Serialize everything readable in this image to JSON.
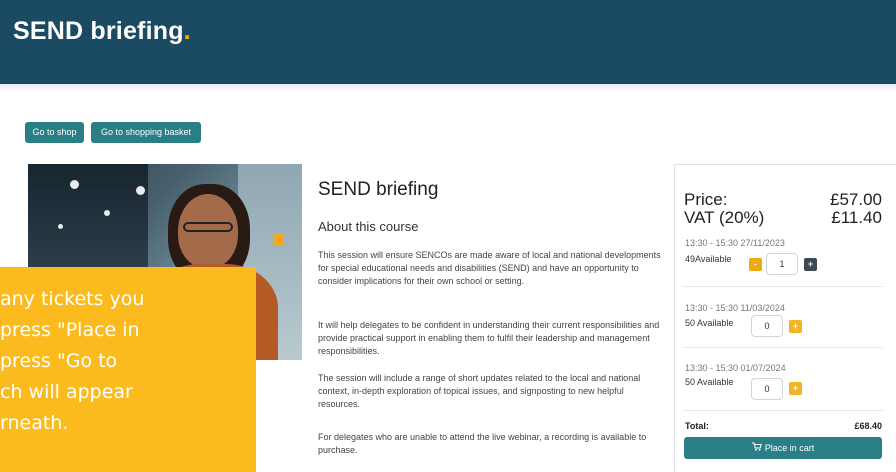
{
  "header": {
    "brand": "SEND briefing",
    "brand_dot": "."
  },
  "nav_buttons": {
    "shop": "Go to shop",
    "basket": "Go to shopping basket"
  },
  "overlay_lines": [
    "any tickets you",
    " press \"Place in",
    "press \"Go to",
    "ch will appear",
    "rneath."
  ],
  "course": {
    "title": "SEND briefing",
    "about_heading": "About this course",
    "paragraphs": [
      "This session will ensure SENCOs are made aware of local and national developments for special educational needs and disabilities (SEND) and have an opportunity to consider implications for their own school or setting.",
      "It will help delegates to be confident in understanding their current responsibilities and provide practical support in enabling them to fulfil their leadership and management responsibilities.",
      "The session will include a range of short updates related to the local and national context, in-depth exploration of topical issues, and signposting to new helpful resources.",
      "For delegates who are unable to attend the live webinar, a recording is available to purchase."
    ]
  },
  "pricing": {
    "price_label": "Price:",
    "price_value": "£57.00",
    "vat_label": "VAT (20%)",
    "vat_value": "£11.40"
  },
  "sessions": [
    {
      "date": "13:30 - 15:30 27/11/2023",
      "available": "49Available",
      "quantity": "1",
      "minus": "-",
      "plus": "+"
    },
    {
      "date": "13:30 - 15:30 11/03/2024",
      "available": "50 Available",
      "quantity": "0",
      "plus": "+"
    },
    {
      "date": "13:30 - 15:30 01/07/2024",
      "available": "50 Available",
      "quantity": "0",
      "plus": "+"
    }
  ],
  "total": {
    "label": "Total:",
    "value": "£68.40"
  },
  "cart_button": {
    "icon": "cart-icon",
    "label": "Place in cart"
  },
  "colors": {
    "header_bg": "#1b4a63",
    "accent_yellow": "#fbbb1f",
    "teal": "#2a7f86"
  }
}
